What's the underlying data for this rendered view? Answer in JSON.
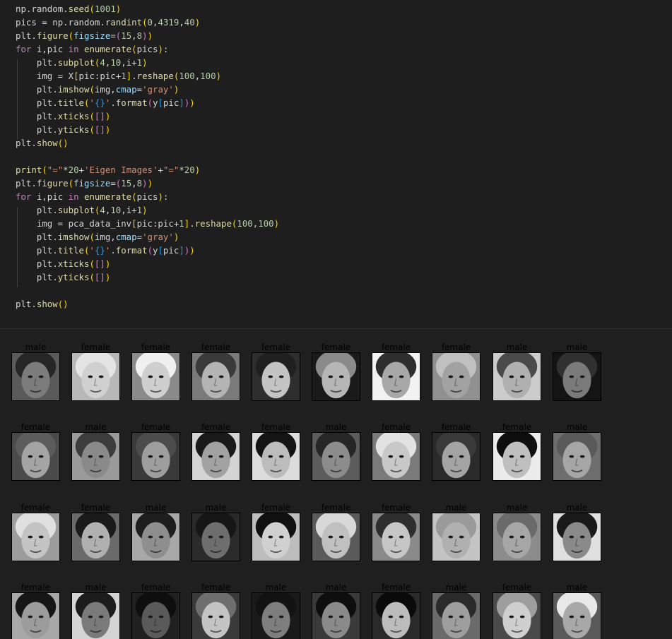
{
  "code_lines": [
    [
      [
        "np",
        "pl"
      ],
      [
        ".",
        "pl"
      ],
      [
        "random",
        "pl"
      ],
      [
        ".",
        "pl"
      ],
      [
        "seed",
        "fn"
      ],
      [
        "(",
        "br1"
      ],
      [
        "1001",
        "num"
      ],
      [
        ")",
        "br1"
      ]
    ],
    [
      [
        "pics",
        "pl"
      ],
      [
        " = ",
        "pl"
      ],
      [
        "np",
        "pl"
      ],
      [
        ".",
        "pl"
      ],
      [
        "random",
        "pl"
      ],
      [
        ".",
        "pl"
      ],
      [
        "randint",
        "fn"
      ],
      [
        "(",
        "br1"
      ],
      [
        "0",
        "num"
      ],
      [
        ",",
        "pl"
      ],
      [
        "4319",
        "num"
      ],
      [
        ",",
        "pl"
      ],
      [
        "40",
        "num"
      ],
      [
        ")",
        "br1"
      ]
    ],
    [
      [
        "plt",
        "pl"
      ],
      [
        ".",
        "pl"
      ],
      [
        "figure",
        "fn"
      ],
      [
        "(",
        "br1"
      ],
      [
        "figsize",
        "var"
      ],
      [
        "=",
        "pl"
      ],
      [
        "(",
        "br2"
      ],
      [
        "15",
        "num"
      ],
      [
        ",",
        "pl"
      ],
      [
        "8",
        "num"
      ],
      [
        ")",
        "br2"
      ],
      [
        ")",
        "br1"
      ]
    ],
    [
      [
        "for",
        "kw"
      ],
      [
        " i,pic ",
        "pl"
      ],
      [
        "in",
        "kw"
      ],
      [
        " ",
        "pl"
      ],
      [
        "enumerate",
        "fn"
      ],
      [
        "(",
        "br1"
      ],
      [
        "pics",
        "pl"
      ],
      [
        ")",
        "br1"
      ],
      [
        ":",
        "pl"
      ]
    ],
    [
      [
        "    plt",
        "pl"
      ],
      [
        ".",
        "pl"
      ],
      [
        "subplot",
        "fn"
      ],
      [
        "(",
        "br1"
      ],
      [
        "4",
        "num"
      ],
      [
        ",",
        "pl"
      ],
      [
        "10",
        "num"
      ],
      [
        ",",
        "pl"
      ],
      [
        "i+",
        "pl"
      ],
      [
        "1",
        "num"
      ],
      [
        ")",
        "br1"
      ]
    ],
    [
      [
        "    img = X",
        "pl"
      ],
      [
        "[",
        "br1"
      ],
      [
        "pic:pic+",
        "pl"
      ],
      [
        "1",
        "num"
      ],
      [
        "]",
        "br1"
      ],
      [
        ".",
        "pl"
      ],
      [
        "reshape",
        "fn"
      ],
      [
        "(",
        "br1"
      ],
      [
        "100",
        "num"
      ],
      [
        ",",
        "pl"
      ],
      [
        "100",
        "num"
      ],
      [
        ")",
        "br1"
      ]
    ],
    [
      [
        "    plt",
        "pl"
      ],
      [
        ".",
        "pl"
      ],
      [
        "imshow",
        "fn"
      ],
      [
        "(",
        "br1"
      ],
      [
        "img,",
        "pl"
      ],
      [
        "cmap",
        "var"
      ],
      [
        "=",
        "pl"
      ],
      [
        "'gray'",
        "str"
      ],
      [
        ")",
        "br1"
      ]
    ],
    [
      [
        "    plt",
        "pl"
      ],
      [
        ".",
        "pl"
      ],
      [
        "title",
        "fn"
      ],
      [
        "(",
        "br1"
      ],
      [
        "'",
        "str"
      ],
      [
        "{}",
        "br3"
      ],
      [
        "'",
        "str"
      ],
      [
        ".",
        "pl"
      ],
      [
        "format",
        "fn"
      ],
      [
        "(",
        "br2"
      ],
      [
        "y",
        "pl"
      ],
      [
        "[",
        "br3"
      ],
      [
        "pic",
        "pl"
      ],
      [
        "]",
        "br3"
      ],
      [
        ")",
        "br2"
      ],
      [
        ")",
        "br1"
      ]
    ],
    [
      [
        "    plt",
        "pl"
      ],
      [
        ".",
        "pl"
      ],
      [
        "xticks",
        "fn"
      ],
      [
        "(",
        "br1"
      ],
      [
        "[",
        "br2"
      ],
      [
        "]",
        "br2"
      ],
      [
        ")",
        "br1"
      ]
    ],
    [
      [
        "    plt",
        "pl"
      ],
      [
        ".",
        "pl"
      ],
      [
        "yticks",
        "fn"
      ],
      [
        "(",
        "br1"
      ],
      [
        "[",
        "br2"
      ],
      [
        "]",
        "br2"
      ],
      [
        ")",
        "br1"
      ]
    ],
    [
      [
        "plt",
        "pl"
      ],
      [
        ".",
        "pl"
      ],
      [
        "show",
        "fn"
      ],
      [
        "(",
        "br1"
      ],
      [
        ")",
        "br1"
      ]
    ],
    [],
    [
      [
        "print",
        "fn"
      ],
      [
        "(",
        "br1"
      ],
      [
        "\"=\"",
        "str"
      ],
      [
        "*",
        "pl"
      ],
      [
        "20",
        "num"
      ],
      [
        "+",
        "pl"
      ],
      [
        "'Eigen Images'",
        "str"
      ],
      [
        "+",
        "pl"
      ],
      [
        "\"=\"",
        "str"
      ],
      [
        "*",
        "pl"
      ],
      [
        "20",
        "num"
      ],
      [
        ")",
        "br1"
      ]
    ],
    [
      [
        "plt",
        "pl"
      ],
      [
        ".",
        "pl"
      ],
      [
        "figure",
        "fn"
      ],
      [
        "(",
        "br1"
      ],
      [
        "figsize",
        "var"
      ],
      [
        "=",
        "pl"
      ],
      [
        "(",
        "br2"
      ],
      [
        "15",
        "num"
      ],
      [
        ",",
        "pl"
      ],
      [
        "8",
        "num"
      ],
      [
        ")",
        "br2"
      ],
      [
        ")",
        "br1"
      ]
    ],
    [
      [
        "for",
        "kw"
      ],
      [
        " i,pic ",
        "pl"
      ],
      [
        "in",
        "kw"
      ],
      [
        " ",
        "pl"
      ],
      [
        "enumerate",
        "fn"
      ],
      [
        "(",
        "br1"
      ],
      [
        "pics",
        "pl"
      ],
      [
        ")",
        "br1"
      ],
      [
        ":",
        "pl"
      ]
    ],
    [
      [
        "    plt",
        "pl"
      ],
      [
        ".",
        "pl"
      ],
      [
        "subplot",
        "fn"
      ],
      [
        "(",
        "br1"
      ],
      [
        "4",
        "num"
      ],
      [
        ",",
        "pl"
      ],
      [
        "10",
        "num"
      ],
      [
        ",",
        "pl"
      ],
      [
        "i+",
        "pl"
      ],
      [
        "1",
        "num"
      ],
      [
        ")",
        "br1"
      ]
    ],
    [
      [
        "    img = pca_data_inv",
        "pl"
      ],
      [
        "[",
        "br1"
      ],
      [
        "pic:pic+",
        "pl"
      ],
      [
        "1",
        "num"
      ],
      [
        "]",
        "br1"
      ],
      [
        ".",
        "pl"
      ],
      [
        "reshape",
        "fn"
      ],
      [
        "(",
        "br1"
      ],
      [
        "100",
        "num"
      ],
      [
        ",",
        "pl"
      ],
      [
        "100",
        "num"
      ],
      [
        ")",
        "br1"
      ]
    ],
    [
      [
        "    plt",
        "pl"
      ],
      [
        ".",
        "pl"
      ],
      [
        "imshow",
        "fn"
      ],
      [
        "(",
        "br1"
      ],
      [
        "img,",
        "pl"
      ],
      [
        "cmap",
        "var"
      ],
      [
        "=",
        "pl"
      ],
      [
        "'gray'",
        "str"
      ],
      [
        ")",
        "br1"
      ]
    ],
    [
      [
        "    plt",
        "pl"
      ],
      [
        ".",
        "pl"
      ],
      [
        "title",
        "fn"
      ],
      [
        "(",
        "br1"
      ],
      [
        "'",
        "str"
      ],
      [
        "{}",
        "br3"
      ],
      [
        "'",
        "str"
      ],
      [
        ".",
        "pl"
      ],
      [
        "format",
        "fn"
      ],
      [
        "(",
        "br2"
      ],
      [
        "y",
        "pl"
      ],
      [
        "[",
        "br3"
      ],
      [
        "pic",
        "pl"
      ],
      [
        "]",
        "br3"
      ],
      [
        ")",
        "br2"
      ],
      [
        ")",
        "br1"
      ]
    ],
    [
      [
        "    plt",
        "pl"
      ],
      [
        ".",
        "pl"
      ],
      [
        "xticks",
        "fn"
      ],
      [
        "(",
        "br1"
      ],
      [
        "[",
        "br2"
      ],
      [
        "]",
        "br2"
      ],
      [
        ")",
        "br1"
      ]
    ],
    [
      [
        "    plt",
        "pl"
      ],
      [
        ".",
        "pl"
      ],
      [
        "yticks",
        "fn"
      ],
      [
        "(",
        "br1"
      ],
      [
        "[",
        "br2"
      ],
      [
        "]",
        "br2"
      ],
      [
        ")",
        "br1"
      ]
    ],
    [],
    [
      [
        "plt",
        "pl"
      ],
      [
        ".",
        "pl"
      ],
      [
        "show",
        "fn"
      ],
      [
        "(",
        "br1"
      ],
      [
        ")",
        "br1"
      ]
    ]
  ],
  "output": {
    "rows": [
      [
        {
          "label": "male",
          "bg": "#5a5a5a",
          "skin": "#7c7c7c",
          "hair": "#262626"
        },
        {
          "label": "female",
          "bg": "#b8b8b8",
          "skin": "#d0d0d0",
          "hair": "#e4e4e4"
        },
        {
          "label": "female",
          "bg": "#8a8a8a",
          "skin": "#cfcfcf",
          "hair": "#f0f0f0"
        },
        {
          "label": "female",
          "bg": "#7a7a7a",
          "skin": "#b4b4b4",
          "hair": "#3a3a3a"
        },
        {
          "label": "female",
          "bg": "#2e2e2e",
          "skin": "#c4c4c4",
          "hair": "#202020"
        },
        {
          "label": "female",
          "bg": "#1a1a1a",
          "skin": "#b6b6b6",
          "hair": "#8a8a8a"
        },
        {
          "label": "female",
          "bg": "#f2f2f2",
          "skin": "#a8a8a8",
          "hair": "#2e2e2e"
        },
        {
          "label": "female",
          "bg": "#909090",
          "skin": "#a2a2a2",
          "hair": "#c0c0c0"
        },
        {
          "label": "male",
          "bg": "#cccccc",
          "skin": "#b0b0b0",
          "hair": "#4a4a4a"
        },
        {
          "label": "male",
          "bg": "#141414",
          "skin": "#7a7a7a",
          "hair": "#303030"
        }
      ],
      [
        {
          "label": "female",
          "bg": "#4a4a4a",
          "skin": "#a4a4a4",
          "hair": "#5c5c5c"
        },
        {
          "label": "male",
          "bg": "#9a9a9a",
          "skin": "#8a8a8a",
          "hair": "#3c3c3c"
        },
        {
          "label": "female",
          "bg": "#3a3a3a",
          "skin": "#9e9e9e",
          "hair": "#4c4c4c"
        },
        {
          "label": "female",
          "bg": "#d4d4d4",
          "skin": "#a2a2a2",
          "hair": "#1a1a1a"
        },
        {
          "label": "female",
          "bg": "#dcdcdc",
          "skin": "#bcbcbc",
          "hair": "#141414"
        },
        {
          "label": "male",
          "bg": "#5c5c5c",
          "skin": "#8c8c8c",
          "hair": "#262626"
        },
        {
          "label": "female",
          "bg": "#7a7a7a",
          "skin": "#c8c8c8",
          "hair": "#e2e2e2"
        },
        {
          "label": "female",
          "bg": "#2a2a2a",
          "skin": "#a4a4a4",
          "hair": "#3a3a3a"
        },
        {
          "label": "female",
          "bg": "#ececec",
          "skin": "#bfbfbf",
          "hair": "#0e0e0e"
        },
        {
          "label": "male",
          "bg": "#6e6e6e",
          "skin": "#a6a6a6",
          "hair": "#5a5a5a"
        }
      ],
      [
        {
          "label": "female",
          "bg": "#9c9c9c",
          "skin": "#c4c4c4",
          "hair": "#e0e0e0"
        },
        {
          "label": "female",
          "bg": "#6a6a6a",
          "skin": "#b0b0b0",
          "hair": "#1a1a1a"
        },
        {
          "label": "male",
          "bg": "#a8a8a8",
          "skin": "#8e8e8e",
          "hair": "#1e1e1e"
        },
        {
          "label": "male",
          "bg": "#2a2a2a",
          "skin": "#6e6e6e",
          "hair": "#161616"
        },
        {
          "label": "female",
          "bg": "#bdbdbd",
          "skin": "#d0d0d0",
          "hair": "#101010"
        },
        {
          "label": "female",
          "bg": "#5a5a5a",
          "skin": "#c0c0c0",
          "hair": "#d8d8d8"
        },
        {
          "label": "female",
          "bg": "#8a8a8a",
          "skin": "#c6c6c6",
          "hair": "#2e2e2e"
        },
        {
          "label": "male",
          "bg": "#c4c4c4",
          "skin": "#b0b0b0",
          "hair": "#9a9a9a"
        },
        {
          "label": "male",
          "bg": "#8c8c8c",
          "skin": "#a6a6a6",
          "hair": "#6a6a6a"
        },
        {
          "label": "male",
          "bg": "#e0e0e0",
          "skin": "#8a8a8a",
          "hair": "#1a1a1a"
        }
      ],
      [
        {
          "label": "female",
          "bg": "#a8a8a8",
          "skin": "#9c9c9c",
          "hair": "#161616"
        },
        {
          "label": "male",
          "bg": "#d4d4d4",
          "skin": "#7a7a7a",
          "hair": "#1c1c1c"
        },
        {
          "label": "female",
          "bg": "#202020",
          "skin": "#5a5a5a",
          "hair": "#0e0e0e"
        },
        {
          "label": "female",
          "bg": "#3a3a3a",
          "skin": "#c4c4c4",
          "hair": "#6e6e6e"
        },
        {
          "label": "male",
          "bg": "#1a1a1a",
          "skin": "#7e7e7e",
          "hair": "#121212"
        },
        {
          "label": "male",
          "bg": "#3a3a3a",
          "skin": "#8a8a8a",
          "hair": "#0e0e0e"
        },
        {
          "label": "female",
          "bg": "#2a2a2a",
          "skin": "#bcbcbc",
          "hair": "#0a0a0a"
        },
        {
          "label": "male",
          "bg": "#6a6a6a",
          "skin": "#9e9e9e",
          "hair": "#2a2a2a"
        },
        {
          "label": "female",
          "bg": "#4a4a4a",
          "skin": "#cfcfcf",
          "hair": "#9e9e9e"
        },
        {
          "label": "male",
          "bg": "#5a5a5a",
          "skin": "#a8a8a8",
          "hair": "#e8e8e8"
        }
      ]
    ]
  }
}
